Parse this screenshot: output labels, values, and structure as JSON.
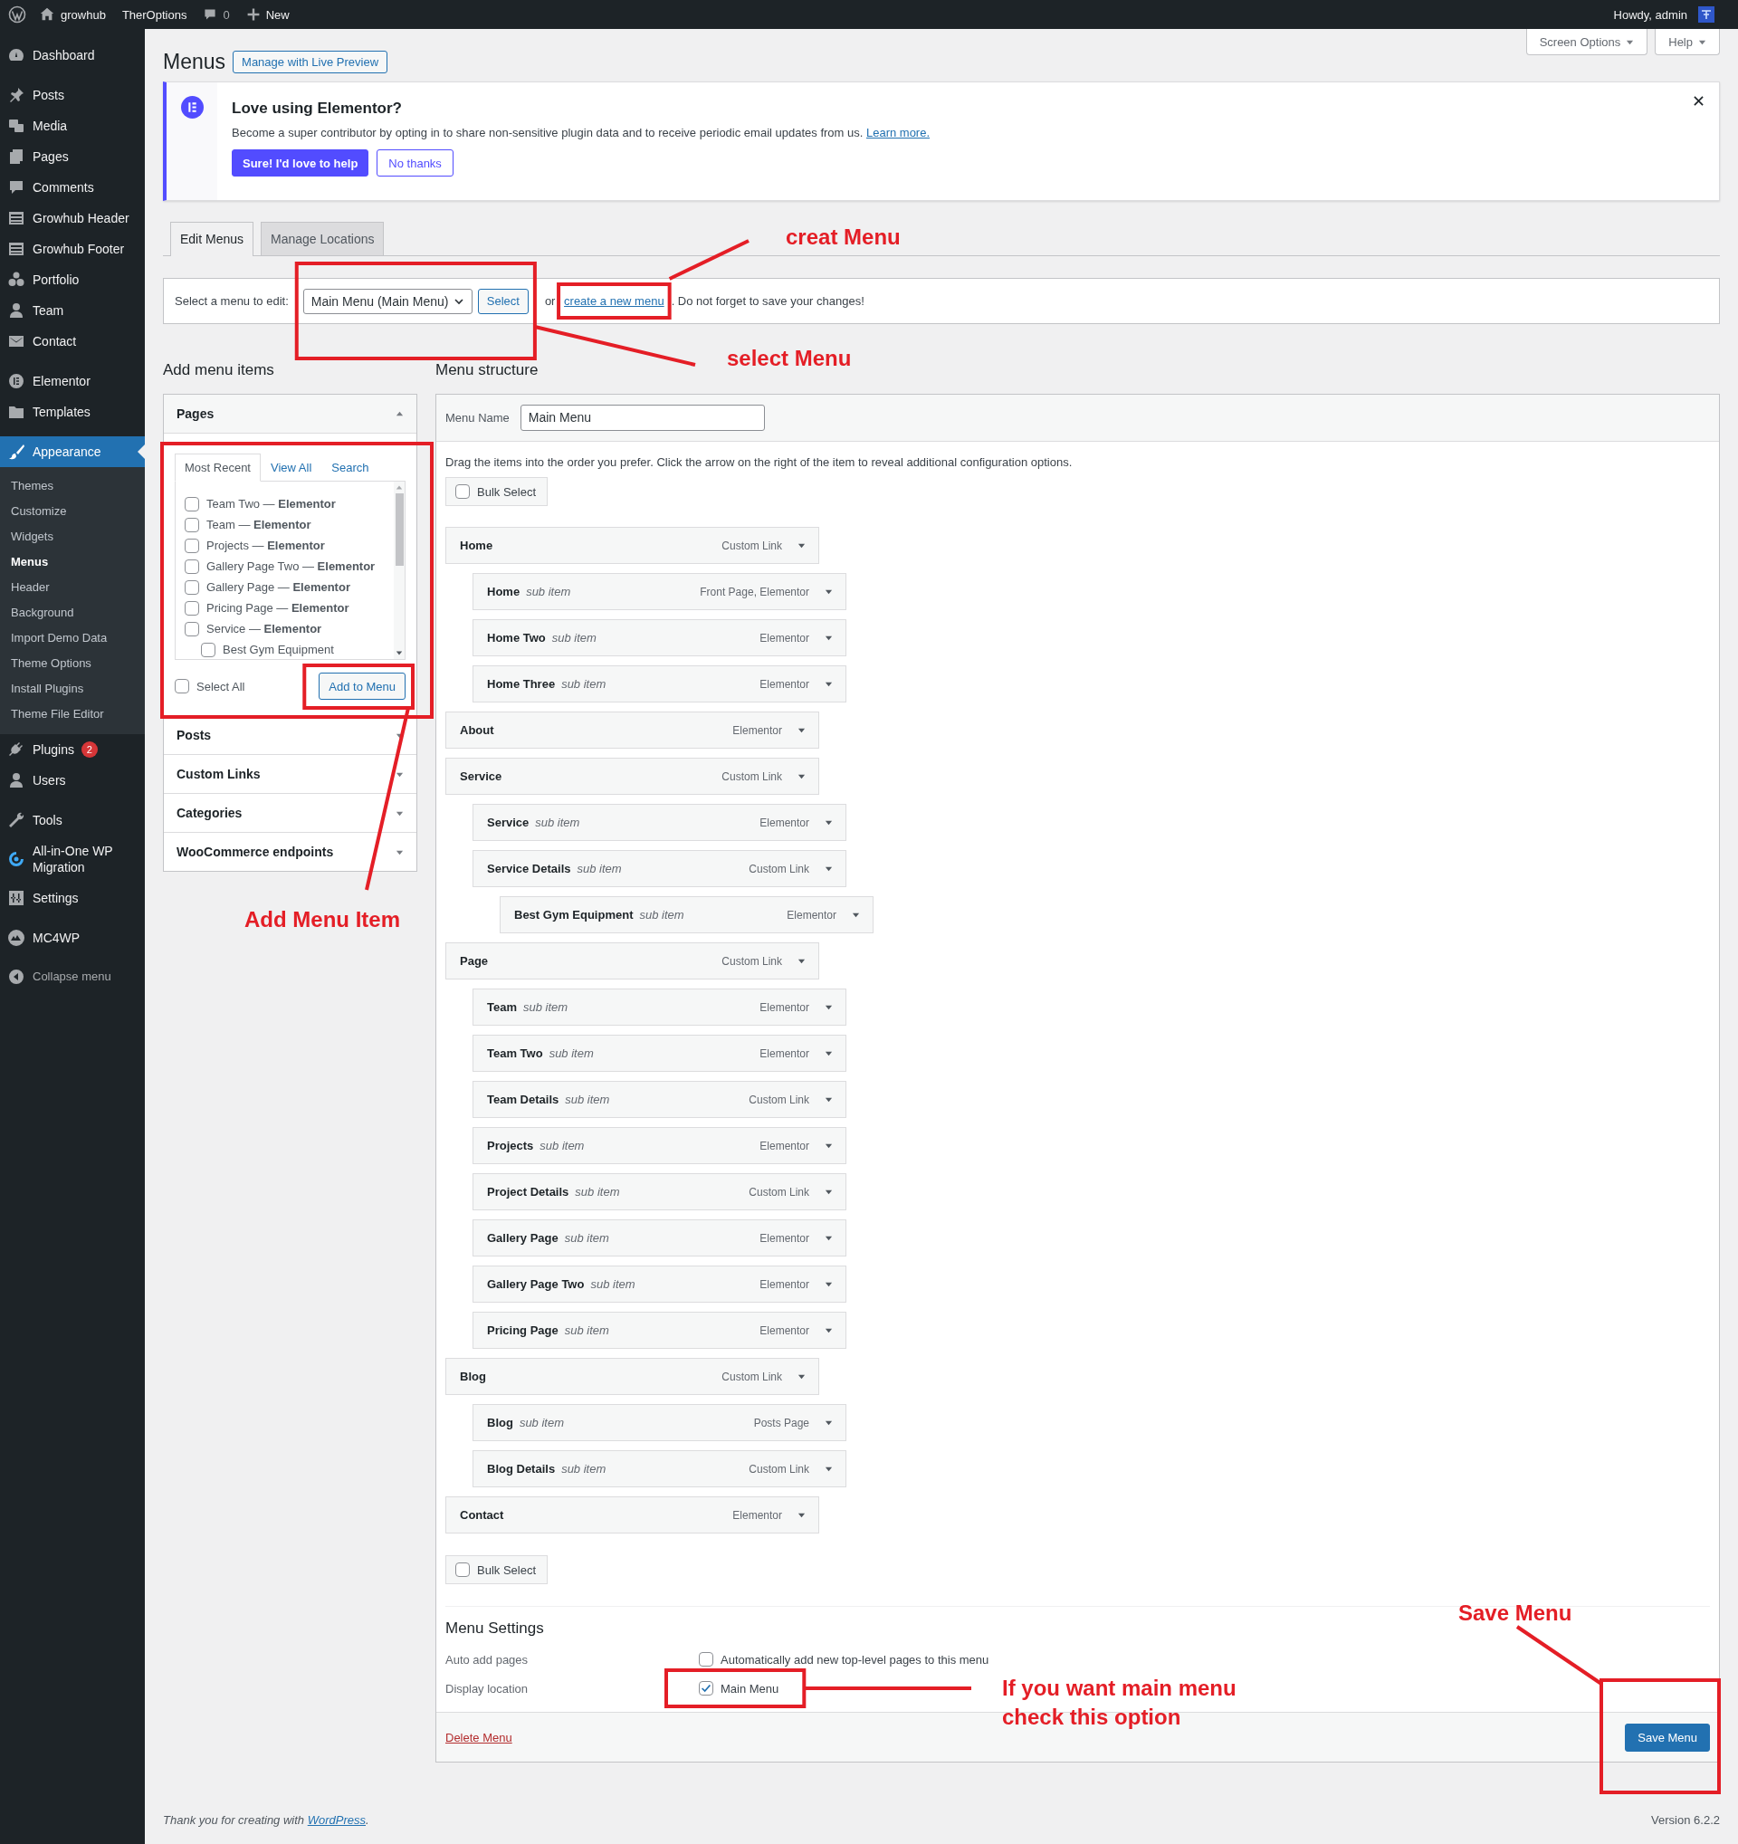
{
  "admin_bar": {
    "site": "growhub",
    "theme_options": "TherOptions",
    "comments": "0",
    "new": "New",
    "greeting": "Howdy, admin"
  },
  "sidebar": {
    "groups": [
      {
        "items": [
          {
            "label": "Dashboard",
            "selected": false
          }
        ]
      },
      {
        "items": [
          {
            "label": "Posts",
            "selected": false
          },
          {
            "label": "Media",
            "selected": false
          },
          {
            "label": "Pages",
            "selected": false
          },
          {
            "label": "Comments",
            "selected": false
          },
          {
            "label": "Growhub Header",
            "selected": false
          },
          {
            "label": "Growhub Footer",
            "selected": false
          },
          {
            "label": "Portfolio",
            "selected": false
          },
          {
            "label": "Team",
            "selected": false
          },
          {
            "label": "Contact",
            "selected": false
          }
        ]
      },
      {
        "items": [
          {
            "label": "Elementor",
            "selected": false
          },
          {
            "label": "Templates",
            "selected": false
          }
        ]
      },
      {
        "items": [
          {
            "label": "Appearance",
            "selected": true,
            "children": [
              {
                "label": "Themes",
                "selected": false
              },
              {
                "label": "Customize",
                "selected": false
              },
              {
                "label": "Widgets",
                "selected": false
              },
              {
                "label": "Menus",
                "selected": true
              },
              {
                "label": "Header",
                "selected": false
              },
              {
                "label": "Background",
                "selected": false
              },
              {
                "label": "Import Demo Data",
                "selected": false
              },
              {
                "label": "Theme Options",
                "selected": false
              },
              {
                "label": "Install Plugins",
                "selected": false
              },
              {
                "label": "Theme File Editor",
                "selected": false
              }
            ]
          },
          {
            "label": "Plugins",
            "selected": false,
            "badge": "2"
          },
          {
            "label": "Users",
            "selected": false
          }
        ]
      },
      {
        "items": [
          {
            "label": "Tools",
            "selected": false
          },
          {
            "label": "All-in-One WP Migration",
            "selected": false
          },
          {
            "label": "Settings",
            "selected": false
          }
        ]
      },
      {
        "items": [
          {
            "label": "MC4WP",
            "selected": false
          }
        ]
      }
    ],
    "collapse": "Collapse menu"
  },
  "page": {
    "title": "Menus",
    "live_preview": "Manage with Live Preview",
    "screen_options": "Screen Options",
    "help": "Help"
  },
  "notice": {
    "title": "Love using Elementor?",
    "text": "Become a super contributor by opting in to share non-sensitive plugin data and to receive periodic email updates from us. ",
    "link": "Learn more.",
    "accept": "Sure! I'd love to help",
    "decline": "No thanks"
  },
  "tabs": [
    {
      "label": "Edit Menus",
      "selected": true
    },
    {
      "label": "Manage Locations",
      "selected": false
    }
  ],
  "menu_select": {
    "label": "Select a menu to edit:",
    "value": "Main Menu (Main Menu)",
    "button": "Select",
    "or": "or ",
    "link": "create a new menu",
    "after": ". Do not forget to save your changes!"
  },
  "add_items": {
    "title": "Add menu items",
    "sections": [
      {
        "title": "Pages",
        "expanded": true
      },
      {
        "title": "Posts",
        "expanded": false
      },
      {
        "title": "Custom Links",
        "expanded": false
      },
      {
        "title": "Categories",
        "expanded": false
      },
      {
        "title": "WooCommerce endpoints",
        "expanded": false
      }
    ],
    "pages_tabs": [
      {
        "label": "Most Recent",
        "selected": true
      },
      {
        "label": "View All",
        "selected": false
      },
      {
        "label": "Search",
        "selected": false
      }
    ],
    "pages": [
      {
        "title": "Team Two — **Elementor**",
        "checked": false
      },
      {
        "title": "Team — **Elementor**",
        "checked": false
      },
      {
        "title": "Projects — **Elementor**",
        "checked": false
      },
      {
        "title": "Gallery Page Two — **Elementor**",
        "checked": false
      },
      {
        "title": "Gallery Page — **Elementor**",
        "checked": false
      },
      {
        "title": "Pricing Page — **Elementor**",
        "checked": false
      },
      {
        "title": "Service — **Elementor**",
        "checked": false,
        "children": [
          {
            "title": "Best Gym Equipment",
            "checked": false
          }
        ]
      }
    ],
    "select_all": {
      "label": "Select All",
      "checked": false
    },
    "add_button": "Add to Menu"
  },
  "structure": {
    "title": "Menu structure",
    "name_label": "Menu Name",
    "name_value": "Main Menu",
    "hint": "Drag the items into the order you prefer. Click the arrow on the right of the item to reveal additional configuration options.",
    "bulk_select": "Bulk Select",
    "items": [
      {
        "title": "Home",
        "type": "Custom Link",
        "children": [
          {
            "title": "Home",
            "note": "sub item",
            "type": "Front Page, Elementor"
          },
          {
            "title": "Home Two",
            "note": "sub item",
            "type": "Elementor"
          },
          {
            "title": "Home Three",
            "note": "sub item",
            "type": "Elementor"
          }
        ]
      },
      {
        "title": "About",
        "type": "Elementor"
      },
      {
        "title": "Service",
        "type": "Custom Link",
        "children": [
          {
            "title": "Service",
            "note": "sub item",
            "type": "Elementor"
          },
          {
            "title": "Service Details",
            "note": "sub item",
            "type": "Custom Link",
            "children": [
              {
                "title": "Best Gym Equipment",
                "note": "sub item",
                "type": "Elementor"
              }
            ]
          }
        ]
      },
      {
        "title": "Page",
        "type": "Custom Link",
        "children": [
          {
            "title": "Team",
            "note": "sub item",
            "type": "Elementor"
          },
          {
            "title": "Team Two",
            "note": "sub item",
            "type": "Elementor"
          },
          {
            "title": "Team Details",
            "note": "sub item",
            "type": "Custom Link"
          },
          {
            "title": "Projects",
            "note": "sub item",
            "type": "Elementor"
          },
          {
            "title": "Project Details",
            "note": "sub item",
            "type": "Custom Link"
          },
          {
            "title": "Gallery Page",
            "note": "sub item",
            "type": "Elementor"
          },
          {
            "title": "Gallery Page Two",
            "note": "sub item",
            "type": "Elementor"
          },
          {
            "title": "Pricing Page",
            "note": "sub item",
            "type": "Elementor"
          }
        ]
      },
      {
        "title": "Blog",
        "type": "Custom Link",
        "children": [
          {
            "title": "Blog",
            "note": "sub item",
            "type": "Posts Page"
          },
          {
            "title": "Blog Details",
            "note": "sub item",
            "type": "Custom Link"
          }
        ]
      },
      {
        "title": "Contact",
        "type": "Elementor"
      }
    ],
    "bulk_select_bottom": "Bulk Select",
    "settings": {
      "title": "Menu Settings",
      "rows": [
        {
          "label": "Auto add pages",
          "option": "Automatically add new top-level pages to this menu",
          "checked": false
        },
        {
          "label": "Display location",
          "option": "Main Menu",
          "checked": true
        }
      ]
    },
    "delete": "Delete Menu",
    "save": "Save Menu"
  },
  "footer": {
    "text": "Thank you for creating with ",
    "link": "WordPress",
    "end": ".",
    "version": "Version 6.2.2"
  },
  "annotations": [
    {
      "label": "creat Menu"
    },
    {
      "label": "select Menu"
    },
    {
      "label": "Add Menu Item"
    },
    {
      "label": "If you want main menu check this option"
    },
    {
      "label": "Save Menu"
    }
  ]
}
